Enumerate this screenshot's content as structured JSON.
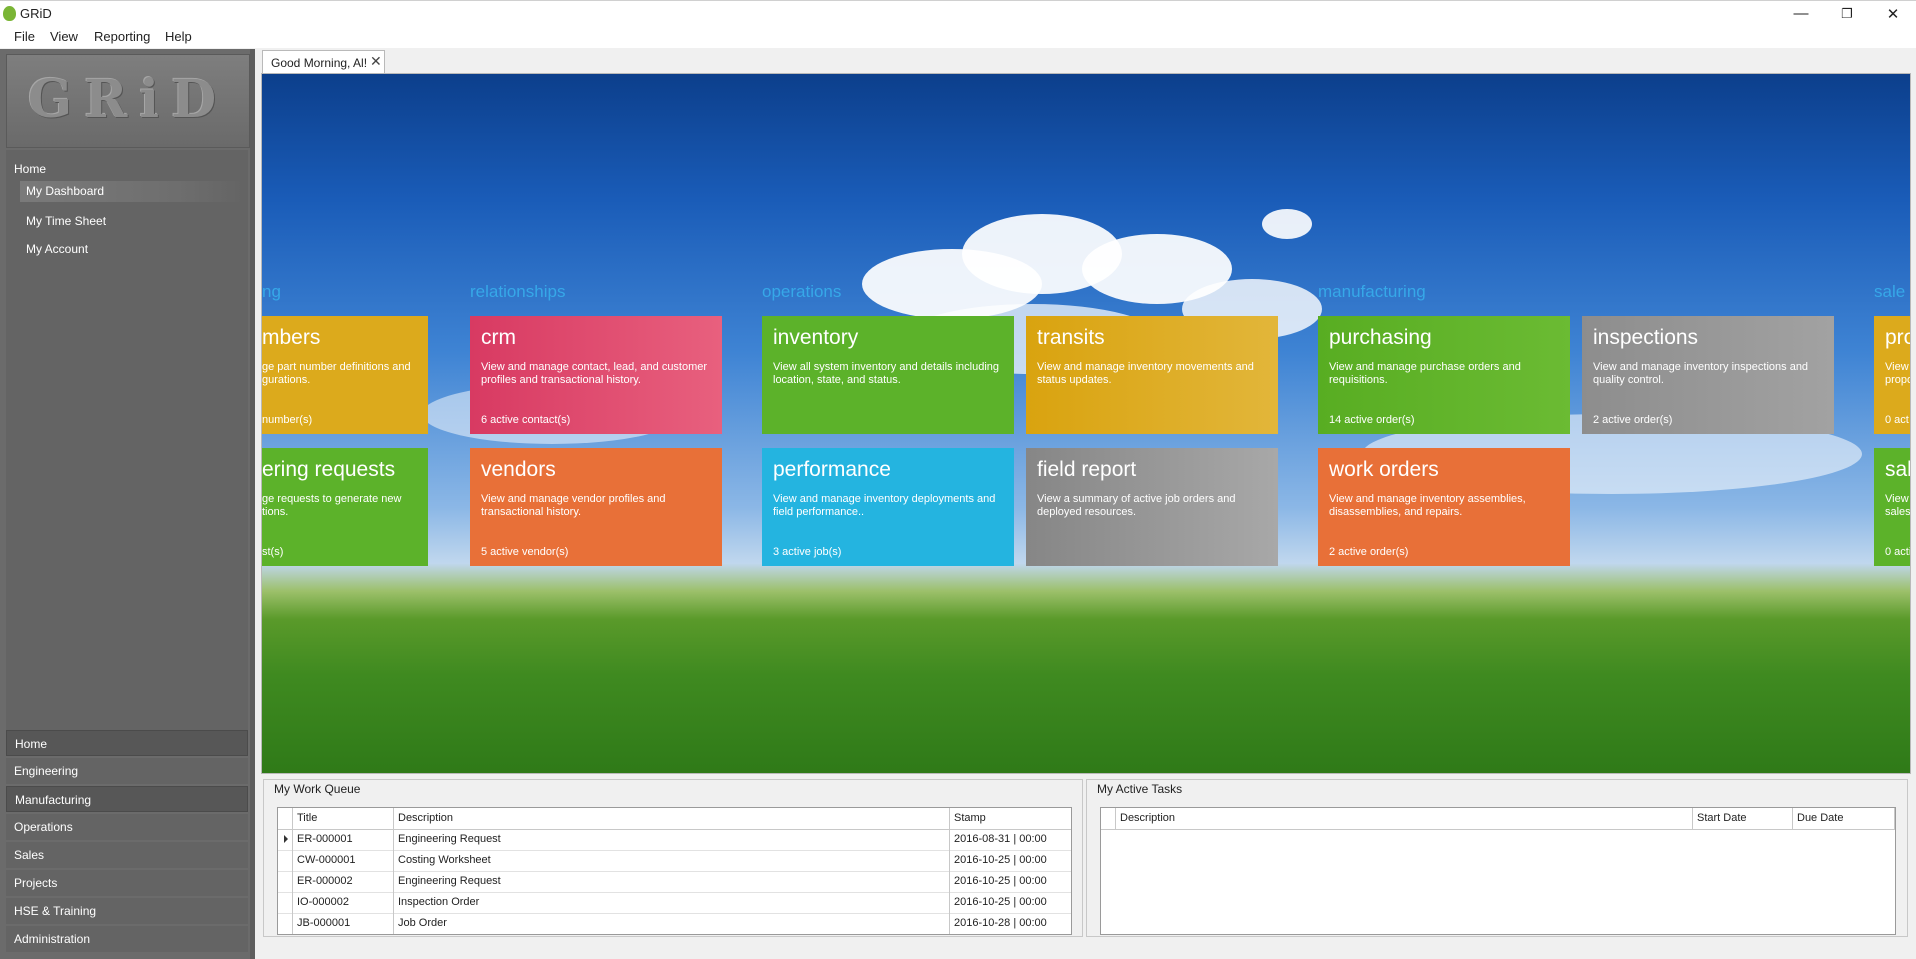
{
  "window": {
    "title": "GRiD",
    "min_glyph": "—",
    "restore_glyph": "❐",
    "close_glyph": "✕"
  },
  "menu": [
    "File",
    "View",
    "Reporting",
    "Help"
  ],
  "sidebar": {
    "logo_text": "GRiD",
    "tree": {
      "root": "Home",
      "items": [
        "My Dashboard",
        "My Time Sheet",
        "My Account"
      ],
      "selected": "My Dashboard"
    },
    "sections": [
      "Home",
      "Engineering",
      "Manufacturing",
      "Operations",
      "Sales",
      "Projects",
      "HSE & Training",
      "Administration"
    ],
    "selected_sections": [
      "Home",
      "Manufacturing"
    ]
  },
  "tab": {
    "label": "Good Morning, Al!",
    "close_glyph": "✕"
  },
  "dashboard": {
    "groups": {
      "engineering_partial": "ng",
      "relationships": "relationships",
      "operations": "operations",
      "manufacturing": "manufacturing",
      "sales_partial": "sale"
    },
    "tiles": {
      "part_numbers": {
        "title": "mbers",
        "desc": "ge part number definitions and\ngurations.",
        "count": "number(s)",
        "color": "#dcaa1c"
      },
      "engineering_requests": {
        "title": "ering requests",
        "desc": "ge requests to generate new\ntions.",
        "count": "st(s)",
        "color": "#5cb22a"
      },
      "crm": {
        "title": "crm",
        "desc": "View and manage contact, lead, and customer profiles and transactional history.",
        "count": "6 active contact(s)",
        "color": "#e0486c"
      },
      "vendors": {
        "title": "vendors",
        "desc": "View and manage vendor profiles and transactional history.",
        "count": "5 active vendor(s)",
        "color": "#e87038"
      },
      "inventory": {
        "title": "inventory",
        "desc": "View all system inventory and details including location, state, and status.",
        "count": "",
        "color": "#5cb22a"
      },
      "performance": {
        "title": "performance",
        "desc": "View and manage inventory deployments and field performance..",
        "count": "3 active job(s)",
        "color": "#24b4e0"
      },
      "transits": {
        "title": "transits",
        "desc": "View and manage inventory movements and status updates.",
        "count": "",
        "color": "#dcaa1c"
      },
      "field_report": {
        "title": "field report",
        "desc": "View a summary of active job orders and deployed resources.",
        "count": "",
        "color": "#959595"
      },
      "purchasing": {
        "title": "purchasing",
        "desc": "View and manage purchase orders and requisitions.",
        "count": "14 active order(s)",
        "color": "#5cb22a"
      },
      "work_orders": {
        "title": "work orders",
        "desc": "View and manage inventory assemblies, disassemblies, and repairs.",
        "count": "2 active order(s)",
        "color": "#e87038"
      },
      "inspections": {
        "title": "inspections",
        "desc": "View and manage inventory inspections and quality control.",
        "count": "2 active order(s)",
        "color": "#959595"
      },
      "proposals_partial": {
        "title": "pro",
        "desc": "View\npropo",
        "count": "0 act",
        "color": "#dcaa1c"
      },
      "sales_partial": {
        "title": "sal",
        "desc": "View\nsales",
        "count": "0 acti",
        "color": "#5cb22a"
      }
    }
  },
  "work_queue": {
    "title": "My Work Queue",
    "columns": [
      "Title",
      "Description",
      "Stamp"
    ],
    "rows": [
      {
        "title": "ER-000001",
        "description": "Engineering Request",
        "stamp": "2016-08-31 | 00:00"
      },
      {
        "title": "CW-000001",
        "description": "Costing Worksheet",
        "stamp": "2016-10-25 | 00:00"
      },
      {
        "title": "ER-000002",
        "description": "Engineering Request",
        "stamp": "2016-10-25 | 00:00"
      },
      {
        "title": "IO-000002",
        "description": "Inspection Order",
        "stamp": "2016-10-25 | 00:00"
      },
      {
        "title": "JB-000001",
        "description": "Job Order",
        "stamp": "2016-10-28 | 00:00"
      }
    ]
  },
  "active_tasks": {
    "title": "My Active Tasks",
    "columns": [
      "Description",
      "Start Date",
      "Due Date"
    ],
    "rows": []
  }
}
